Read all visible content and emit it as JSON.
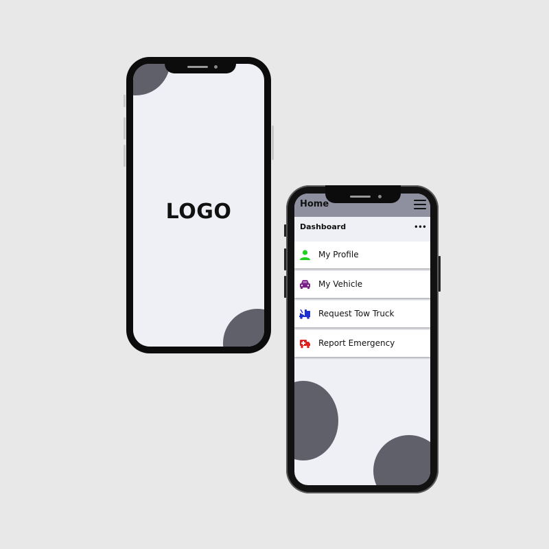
{
  "splash": {
    "logo_text": "LOGO"
  },
  "dashboard": {
    "header_title": "Home",
    "section_title": "Dashboard",
    "more_label": "•••",
    "menu_items": [
      {
        "label": "My Profile",
        "icon": "person-icon",
        "color": "#1fd01f"
      },
      {
        "label": "My Vehicle",
        "icon": "car-icon",
        "color": "#7a1f8a"
      },
      {
        "label": "Request Tow Truck",
        "icon": "tow-truck-icon",
        "color": "#1f2fd0"
      },
      {
        "label": "Report Emergency",
        "icon": "ambulance-icon",
        "color": "#e01f1f"
      }
    ]
  },
  "colors": {
    "background": "#e8e8e8",
    "screen": "#eff0f5",
    "blob": "#5f6069",
    "header": "#8f909f"
  }
}
